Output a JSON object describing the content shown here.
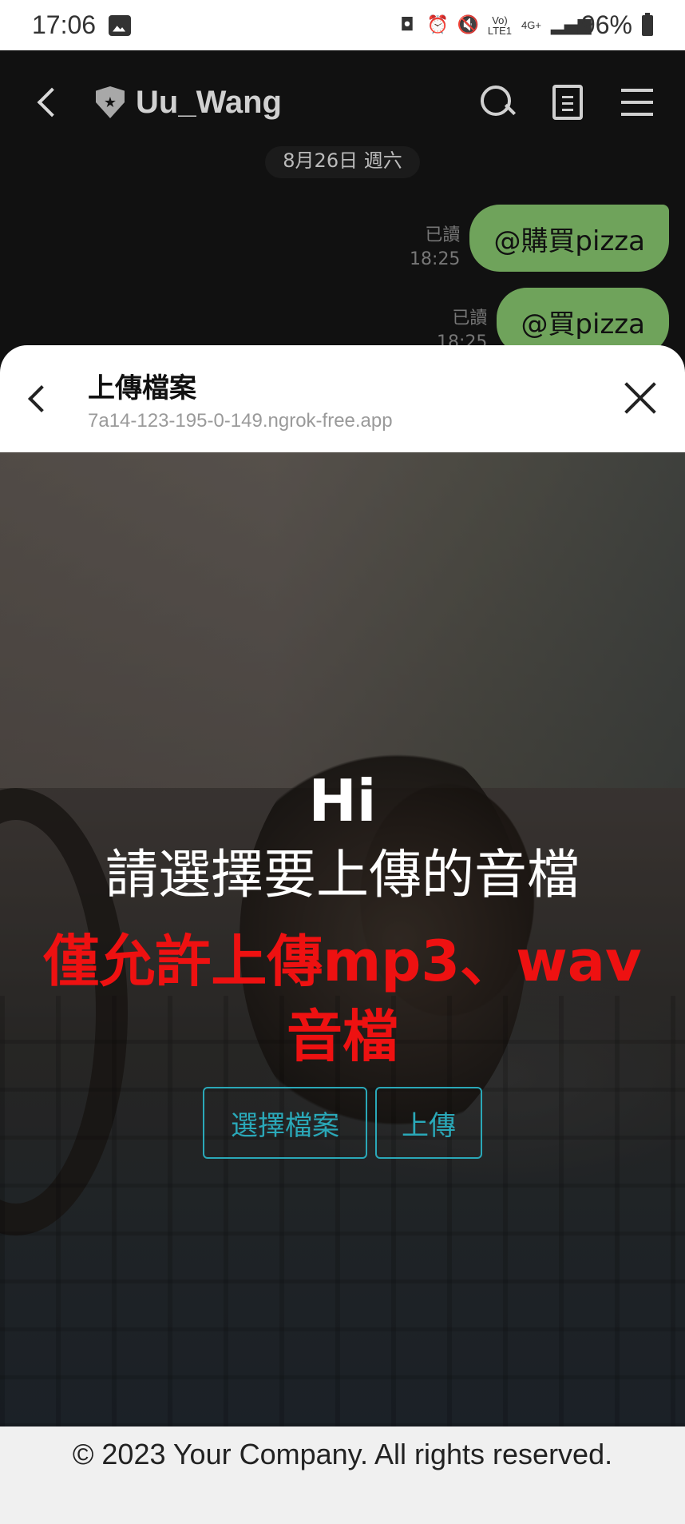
{
  "status_bar": {
    "time": "17:06",
    "network_top": "Vo)",
    "network_bottom": "LTE1",
    "network_type": "4G+",
    "battery_pct": "96%"
  },
  "chat": {
    "title": "Uu_Wang",
    "date_chip": "8月26日 週六",
    "messages": [
      {
        "read": "已讀",
        "time": "18:25",
        "text": "@購買pizza"
      },
      {
        "read": "已讀",
        "time": "18:25",
        "text": "@買pizza"
      }
    ]
  },
  "sheet": {
    "title": "上傳檔案",
    "url": "7a14-123-195-0-149.ngrok-free.app"
  },
  "page": {
    "greeting": "Hi",
    "prompt": "請選擇要上傳的音檔",
    "warning": "僅允許上傳mp3、wav音檔",
    "choose_label": "選擇檔案",
    "upload_label": "上傳",
    "footer": "© 2023 Your Company. All rights reserved."
  },
  "colors": {
    "bubble": "#6fa35b",
    "warning": "#ee1111",
    "button_accent": "#2aa8b8"
  }
}
